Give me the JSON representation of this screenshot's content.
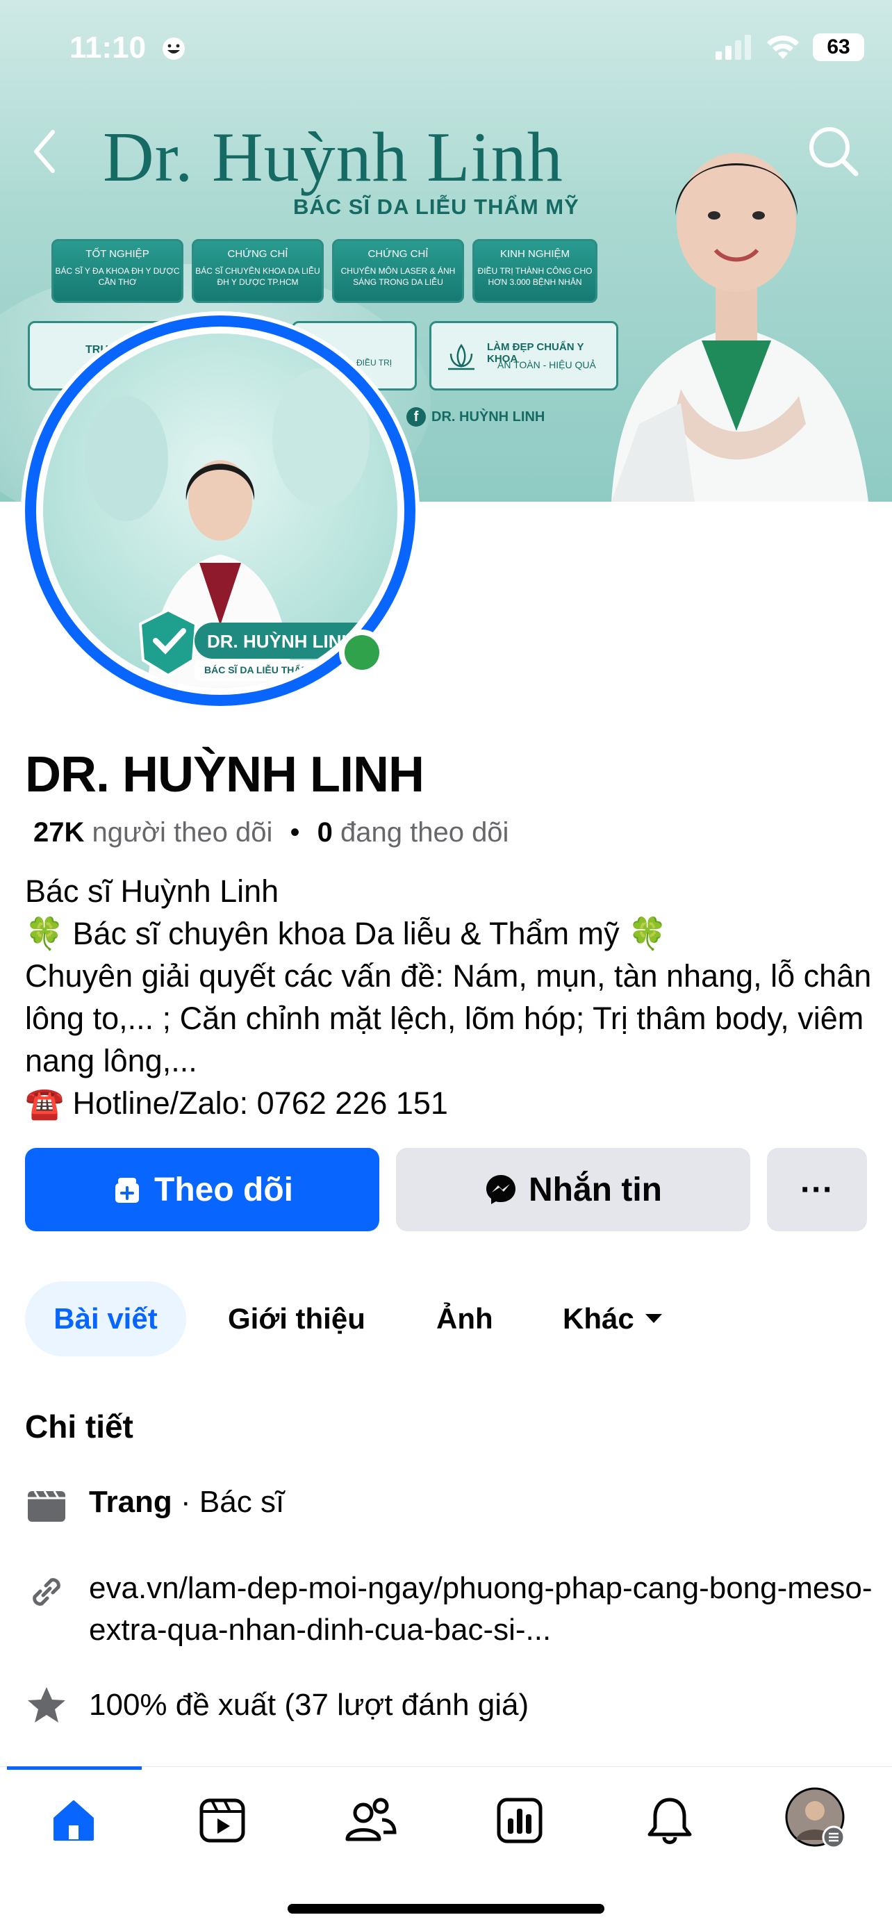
{
  "status_bar": {
    "time": "11:10",
    "battery": "63"
  },
  "cover": {
    "title": "Dr. Huỳnh Linh",
    "subtitle": "BÁC SĨ DA LIỄU THẨM MỸ",
    "cards": [
      {
        "heading": "TỐT NGHIỆP",
        "body": "BÁC SĨ Y ĐA KHOA ĐH Y DƯỢC CẦN THƠ"
      },
      {
        "heading": "CHỨNG CHỈ",
        "body": "BÁC SĨ CHUYÊN KHOA DA LIỄU ĐH Y DƯỢC TP.HCM"
      },
      {
        "heading": "CHỨNG CHỈ",
        "body": "CHUYÊN MÔN LASER & ÁNH SÁNG TRONG DA LIỄU"
      },
      {
        "heading": "KINH NGHIỆM",
        "body": "ĐIỀU TRỊ THÀNH CÔNG CHO HƠN 3.000 BỆNH NHÂN"
      }
    ],
    "card_row2": {
      "left_partial": "TRU",
      "mid_partial": "ĐIỀU TRỊ",
      "right_heading": "LÀM ĐẸP CHUẨN Y KHOA",
      "right_body": "AN TOÀN - HIỆU QUẢ"
    },
    "fb_tag": "DR. HUỲNH LINH"
  },
  "avatar": {
    "badge_name": "DR. HUỲNH LINH",
    "badge_sub": "BÁC SĨ DA LIỄU THẨM MỸ"
  },
  "profile": {
    "name": "DR. HUỲNH LINH",
    "followers_count": "27K",
    "followers_label": "người theo dõi",
    "separator": "•",
    "following_count": "0",
    "following_label": "đang theo dõi",
    "bio": [
      "Bác sĩ Huỳnh Linh",
      "🍀 Bác sĩ chuyên khoa Da liễu & Thẩm mỹ 🍀",
      "Chuyên giải quyết các vấn đề: Nám, mụn, tàn nhang, lỗ chân lông to,... ; Căn chỉnh mặt lệch, lõm hóp; Trị thâm body, viêm nang lông,...",
      "☎️ Hotline/Zalo: 0762 226 151"
    ]
  },
  "actions": {
    "follow": "Theo dõi",
    "message": "Nhắn tin",
    "more": "···"
  },
  "tabs": [
    {
      "label": "Bài viết"
    },
    {
      "label": "Giới thiệu"
    },
    {
      "label": "Ảnh"
    },
    {
      "label": "Khác"
    }
  ],
  "details": {
    "title": "Chi tiết",
    "category_bold": "Trang",
    "category_rest": " · Bác sĩ",
    "link": "eva.vn/lam-dep-moi-ngay/phuong-phap-cang-bong-meso-extra-qua-nhan-dinh-cua-bac-si-...",
    "rating": "100% đề xuất (37 lượt đánh giá)"
  },
  "colors": {
    "accent": "#0866ff",
    "online": "#31a24c",
    "secondary_text": "#65676b"
  }
}
